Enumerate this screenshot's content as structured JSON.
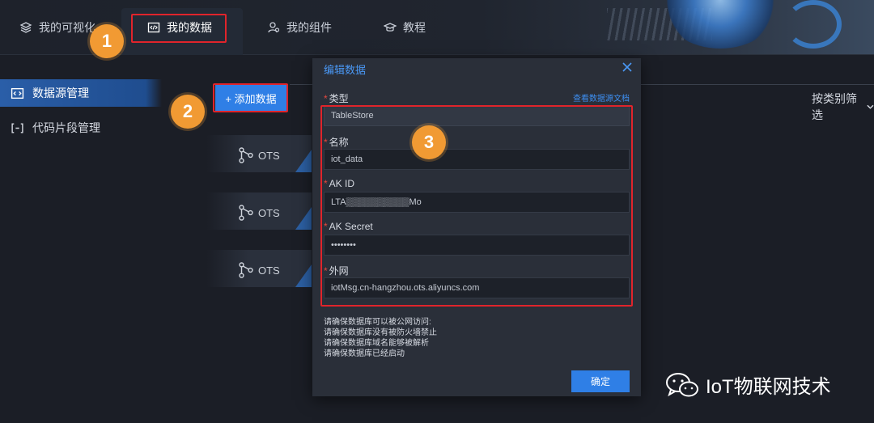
{
  "nav": {
    "items": [
      {
        "label": "我的可视化",
        "icon": "layers-icon"
      },
      {
        "label": "我的数据",
        "icon": "code-window-icon"
      },
      {
        "label": "我的组件",
        "icon": "component-user-icon"
      },
      {
        "label": "教程",
        "icon": "graduation-cap-icon"
      }
    ]
  },
  "sidebar": {
    "items": [
      {
        "label": "数据源管理",
        "icon": "code-window-icon"
      },
      {
        "label": "代码片段管理",
        "icon": "bracket-code-icon"
      }
    ]
  },
  "content": {
    "add_button": "+ 添加数据",
    "filter_label": "按类别筛选",
    "datasources": [
      {
        "label": "OTS",
        "icon": "branch-icon"
      },
      {
        "label": "OTS",
        "icon": "branch-icon"
      },
      {
        "label": "OTS",
        "icon": "branch-icon"
      }
    ]
  },
  "dialog": {
    "title": "编辑数据",
    "doc_link": "查看数据源文档",
    "fields": [
      {
        "label": "类型",
        "value": "TableStore"
      },
      {
        "label": "名称",
        "value": "iot_data"
      },
      {
        "label": "AK ID",
        "value": "LTA▒▒▒▒▒▒▒▒▒▒Mo"
      },
      {
        "label": "AK Secret",
        "value": "••••••••"
      },
      {
        "label": "外网",
        "value": "iotMsg.cn-hangzhou.ots.aliyuncs.com"
      }
    ],
    "notes": [
      "请确保数据库可以被公网访问:",
      "请确保数据库没有被防火墙禁止",
      "请确保数据库域名能够被解析",
      "请确保数据库已经启动"
    ],
    "confirm_label": "确定"
  },
  "annotations": {
    "badges": [
      "1",
      "2",
      "3"
    ],
    "highlight_color": "#e0242b",
    "badge_color": "#f19a33"
  },
  "watermark": {
    "text": "IoT物联网技术"
  },
  "colors": {
    "accent": "#2f7fe6",
    "background": "#1b1e26",
    "dialog_bg": "#2a2f39"
  }
}
